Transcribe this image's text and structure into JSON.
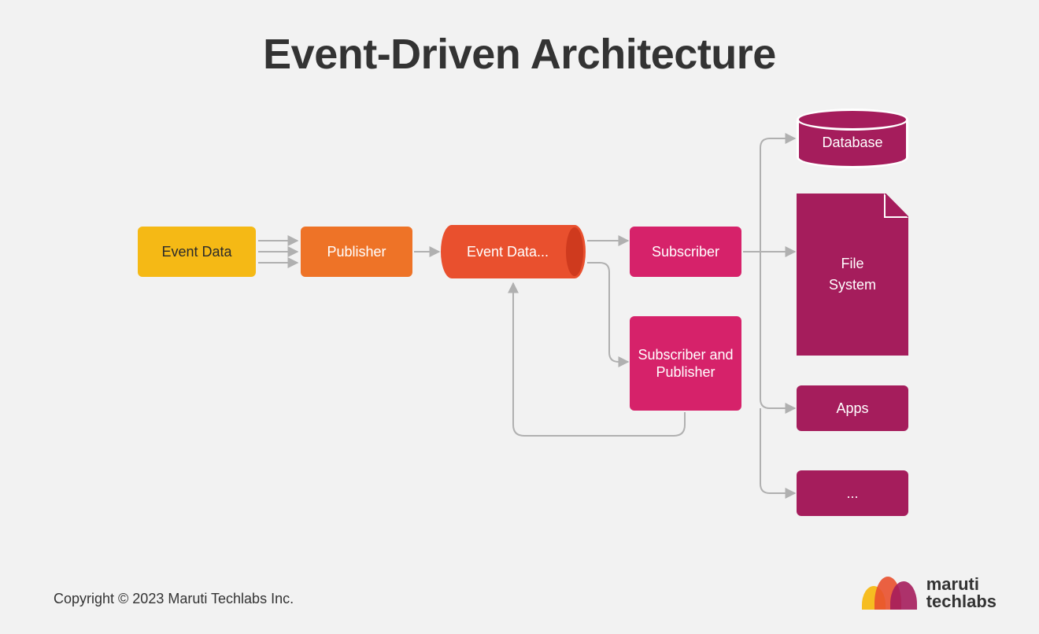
{
  "title": "Event-Driven Architecture",
  "nodes": {
    "event_data": "Event Data",
    "publisher": "Publisher",
    "event_bus": "Event Data...",
    "subscriber": "Subscriber",
    "subscriber_publisher": "Subscriber and Publisher",
    "database": "Database",
    "file_system": "File\nSystem",
    "apps": "Apps",
    "more": "..."
  },
  "copyright": "Copyright © 2023 Maruti Techlabs Inc.",
  "logo": {
    "line1": "maruti",
    "line2": "techlabs"
  },
  "colors": {
    "yellow": "#f5b915",
    "orange": "#ee7327",
    "red_orange": "#e9502e",
    "pink": "#d6226a",
    "magenta": "#a51d5c",
    "text": "#333333",
    "bg": "#f2f2f2",
    "arrow": "#b0b0b0"
  },
  "edges": [
    {
      "from": "event_data",
      "to": "publisher",
      "count": 3
    },
    {
      "from": "publisher",
      "to": "event_bus"
    },
    {
      "from": "event_bus",
      "to": "subscriber"
    },
    {
      "from": "event_bus",
      "to": "subscriber_publisher"
    },
    {
      "from": "subscriber_publisher",
      "to": "event_bus",
      "note": "feedback"
    },
    {
      "from": "subscriber",
      "to": "database"
    },
    {
      "from": "subscriber",
      "to": "file_system"
    },
    {
      "from": "subscriber",
      "to": "apps"
    },
    {
      "from": "subscriber",
      "to": "more"
    }
  ]
}
